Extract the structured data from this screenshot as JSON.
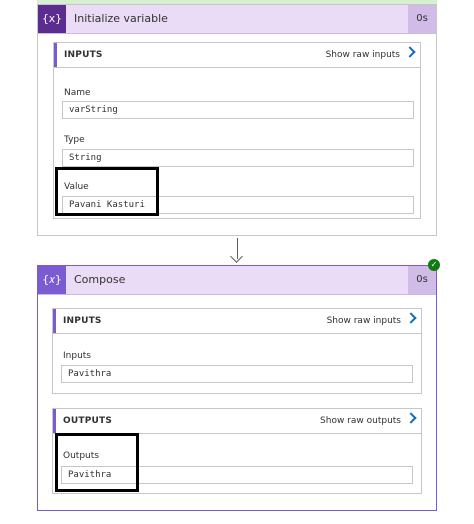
{
  "initialize_card": {
    "icon_text": "{x}",
    "title": "Initialize variable",
    "duration": "0s",
    "inputs": {
      "label": "INPUTS",
      "raw_link": "Show raw inputs",
      "fields": {
        "name": {
          "label": "Name",
          "value": "varString"
        },
        "type": {
          "label": "Type",
          "value": "String"
        },
        "value": {
          "label": "Value",
          "value": "Pavani Kasturi"
        }
      }
    }
  },
  "compose_card": {
    "icon_text": "{𝑥}",
    "title": "Compose",
    "duration": "0s",
    "status_icon": "check-icon",
    "status_color": "#107c10",
    "inputs": {
      "label": "INPUTS",
      "raw_link": "Show raw inputs",
      "field": {
        "label": "Inputs",
        "value": "Pavithra"
      }
    },
    "outputs": {
      "label": "OUTPUTS",
      "raw_link": "Show raw outputs",
      "field": {
        "label": "Outputs",
        "value": "Pavithra"
      }
    }
  },
  "colors": {
    "accent": "#7a5bd1",
    "header_bg": "#eadcf6",
    "icon_bg": "#5c2d91",
    "link_chevron": "#0f6cbd"
  }
}
